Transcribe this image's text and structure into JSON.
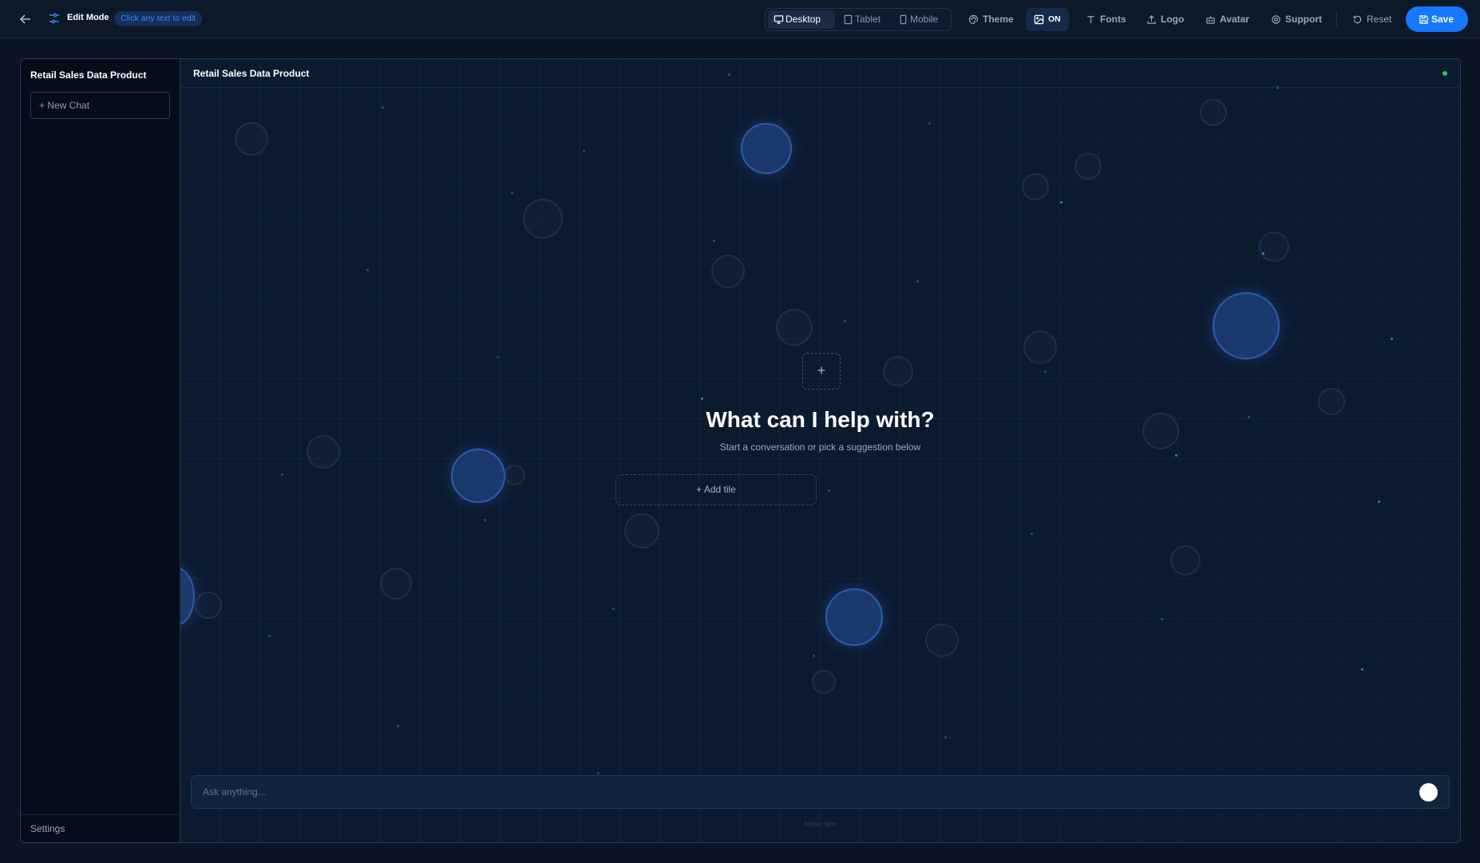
{
  "toolbar": {
    "edit_mode_label": "Edit Mode",
    "edit_hint": "Click any text to edit",
    "devices": [
      {
        "label": "Desktop",
        "active": true
      },
      {
        "label": "Tablet",
        "active": false
      },
      {
        "label": "Mobile",
        "active": false
      }
    ],
    "theme_label": "Theme",
    "background_toggle_label": "ON",
    "fonts_label": "Fonts",
    "logo_label": "Logo",
    "avatar_label": "Avatar",
    "support_label": "Support",
    "reset_label": "Reset",
    "save_label": "Save",
    "accent_color": "#1677ff"
  },
  "sidebar": {
    "brand": "Retail Sales Data Product",
    "new_chat_label": "+ New Chat",
    "settings_label": "Settings"
  },
  "main": {
    "header_title": "Retail Sales Data Product",
    "status_color": "#22c55e",
    "hero_plus": "+",
    "hero_title": "What can I help with?",
    "hero_subtitle": "Start a conversation or pick a suggestion below",
    "add_tile_label": "+  Add tile",
    "ask_placeholder": "Ask anything...",
    "footer_text": "footer text"
  }
}
